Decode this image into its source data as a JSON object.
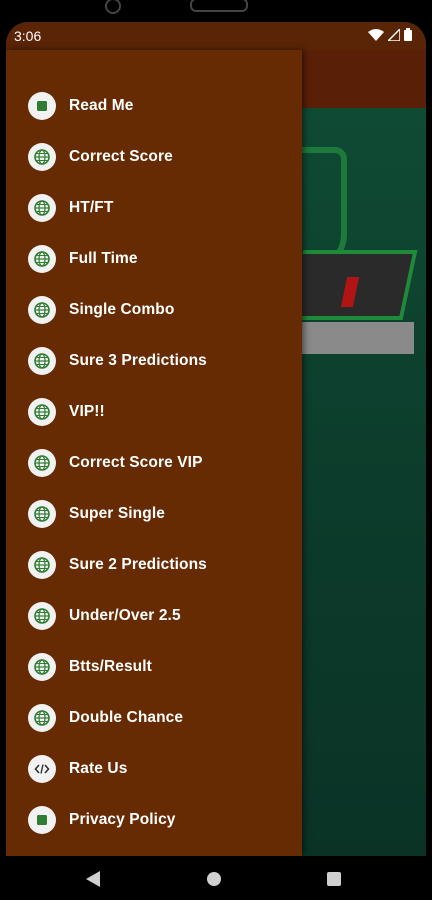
{
  "status_bar": {
    "time": "3:06",
    "icons": [
      "wifi-icon",
      "signal-icon",
      "battery-icon"
    ]
  },
  "colors": {
    "drawer": "#672b04",
    "app_bar": "#5a1f07",
    "content": "#0e3a2a",
    "icon_bg": "#f2f2f2",
    "icon_green": "#2e7d32"
  },
  "drawer": {
    "items": [
      {
        "label": "Read Me",
        "icon": "square-icon"
      },
      {
        "label": "Correct Score",
        "icon": "globe-icon"
      },
      {
        "label": "HT/FT",
        "icon": "globe-icon"
      },
      {
        "label": "Full Time",
        "icon": "globe-icon"
      },
      {
        "label": "Single Combo",
        "icon": "globe-icon"
      },
      {
        "label": "Sure 3 Predictions",
        "icon": "globe-icon"
      },
      {
        "label": "VIP!!",
        "icon": "globe-icon"
      },
      {
        "label": "Correct Score VIP",
        "icon": "globe-icon"
      },
      {
        "label": "Super Single",
        "icon": "globe-icon"
      },
      {
        "label": "Sure 2 Predictions",
        "icon": "globe-icon"
      },
      {
        "label": "Under/Over 2.5",
        "icon": "globe-icon"
      },
      {
        "label": "Btts/Result",
        "icon": "globe-icon"
      },
      {
        "label": "Double Chance",
        "icon": "globe-icon"
      },
      {
        "label": "Rate Us",
        "icon": "code-icon"
      },
      {
        "label": "Privacy Policy",
        "icon": "square-icon"
      }
    ]
  },
  "nav_bar": {
    "buttons": [
      "back-icon",
      "home-icon",
      "recents-icon"
    ]
  }
}
